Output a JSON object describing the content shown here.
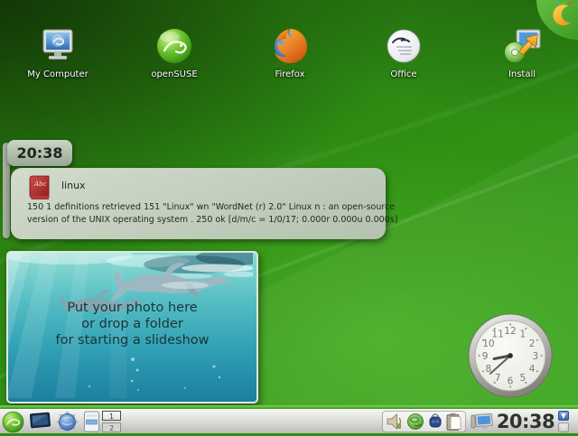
{
  "colors": {
    "wallpaper_green": "#2f9014",
    "panel_green": "#4aa32a",
    "widget_bg": "#c9d3c4",
    "water_teal": "#3aa8b8",
    "crescent_orange": "#f5a623"
  },
  "desktop": {
    "icons": [
      {
        "label": "My Computer",
        "icon": "my-computer-icon"
      },
      {
        "label": "openSUSE",
        "icon": "opensuse-icon"
      },
      {
        "label": "Firefox",
        "icon": "firefox-icon"
      },
      {
        "label": "Office",
        "icon": "office-icon"
      },
      {
        "label": "Install",
        "icon": "install-icon"
      }
    ],
    "toolbox_icon": "plasma-cashew-icon"
  },
  "widgets": {
    "digital_clock": {
      "time": "20:38"
    },
    "dictionary": {
      "icon": "dictionary-book-icon",
      "title": "linux",
      "line1": "150 1 definitions retrieved 151 \"Linux\" wn \"WordNet (r) 2.0\" Linux n : an open-source",
      "line2": "version of the UNIX operating system . 250 ok [d/m/c = 1/0/17; 0.000r 0.000u 0.000s]"
    },
    "photo_frame": {
      "line1": "Put your photo here",
      "line2": "or drop a folder",
      "line3": "for starting a slideshow"
    },
    "analog_clock": {
      "time": "20:38",
      "numbers": [
        "12",
        "1",
        "2",
        "3",
        "4",
        "5",
        "6",
        "7",
        "8",
        "9",
        "10",
        "11"
      ]
    }
  },
  "panel": {
    "launchers": [
      "kickoff-menu",
      "show-desktop",
      "konqueror-browser",
      "file-manager"
    ],
    "pager": {
      "desktop1": "1",
      "desktop2": "2"
    },
    "tray_icons": [
      "volume",
      "network",
      "bluetooth",
      "clipboard"
    ],
    "device_notifier": "device-notifier",
    "clock": "20:38",
    "mini_icons": [
      "updates",
      "tray-box"
    ]
  }
}
